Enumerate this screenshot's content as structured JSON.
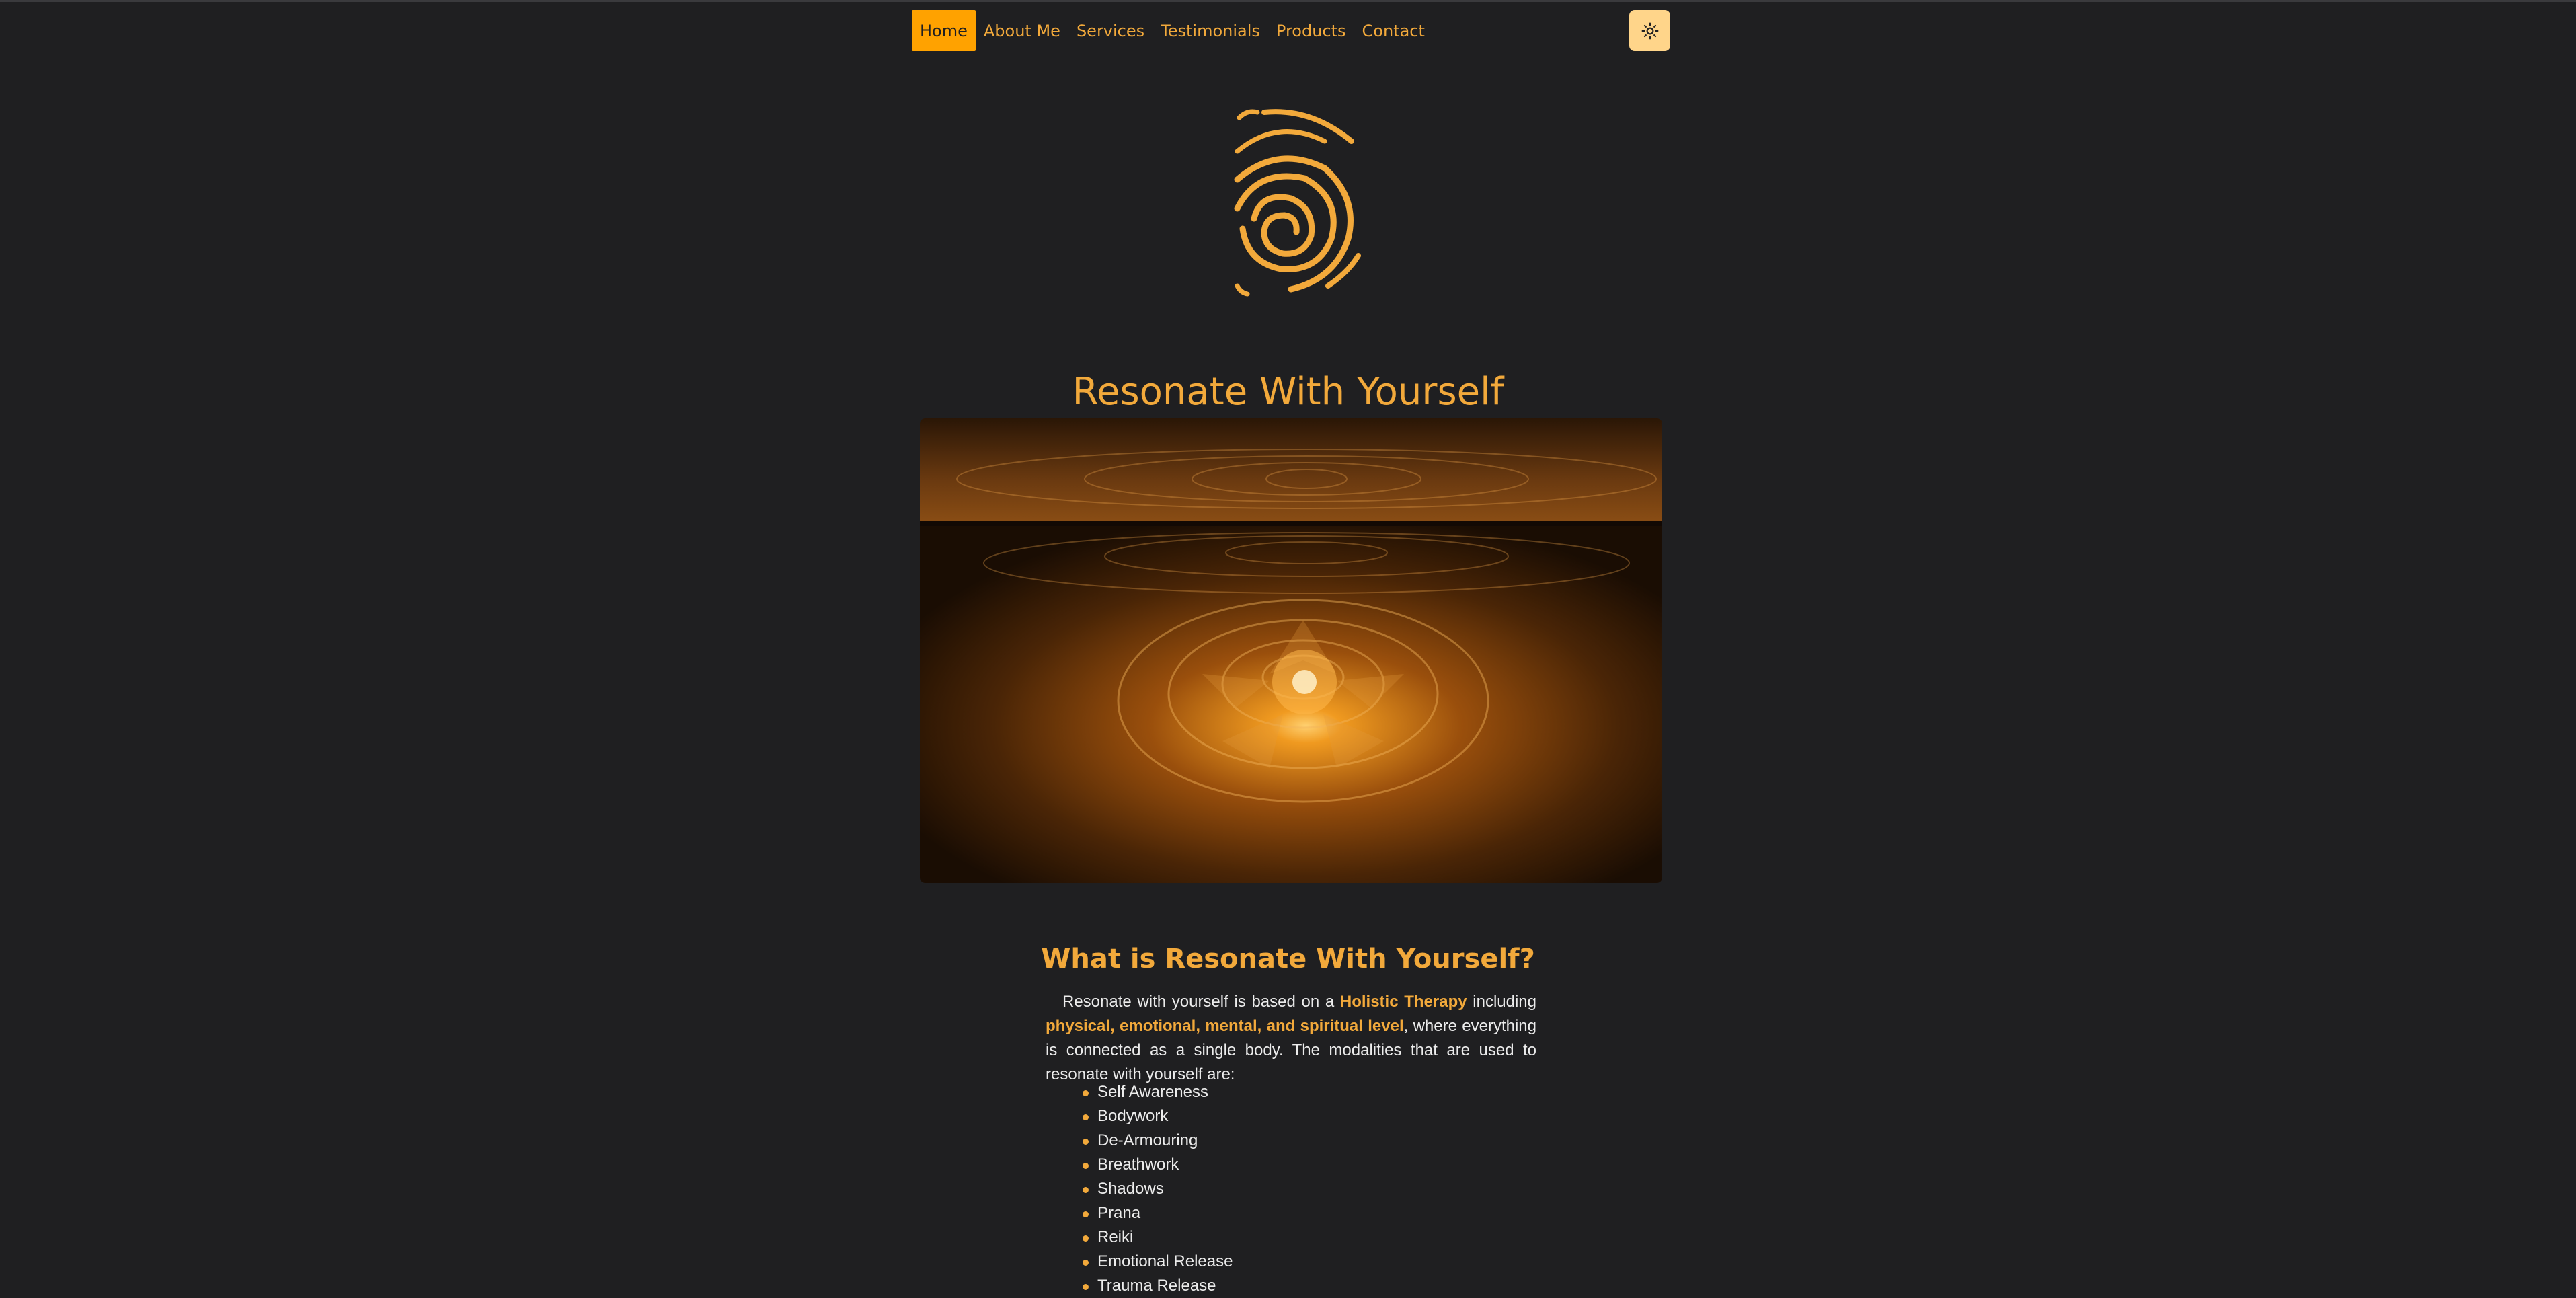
{
  "nav": {
    "items": [
      {
        "label": "Home",
        "active": true
      },
      {
        "label": "About Me",
        "active": false
      },
      {
        "label": "Services",
        "active": false
      },
      {
        "label": "Testimonials",
        "active": false
      },
      {
        "label": "Products",
        "active": false
      },
      {
        "label": "Contact",
        "active": false
      }
    ],
    "theme_toggle_icon": "sun-icon"
  },
  "logo": {
    "icon": "spiral-logo-icon"
  },
  "hero": {
    "title": "Resonate With Yourself",
    "image": "golden-fractal-mandala-image"
  },
  "about": {
    "heading": "What is Resonate With Yourself?",
    "text_1": "Resonate with yourself is based on a ",
    "highlight_1": "Holistic Therapy",
    "text_2": " including ",
    "highlight_2": "physical, emotional, mental, and spiritual level",
    "text_3": ", where everything is connected as a single body. The modalities that are used to resonate with yourself are:",
    "modalities": [
      "Self Awareness",
      "Bodywork",
      "De-Armouring",
      "Breathwork",
      "Shadows",
      "Prana",
      "Reiki",
      "Emotional Release",
      "Trauma Release"
    ]
  },
  "colors": {
    "background": "#1f1f21",
    "accent": "#f2a93b",
    "active_nav": "#ffa200",
    "toggle_bg": "#ffd58a",
    "text": "#ececec"
  }
}
